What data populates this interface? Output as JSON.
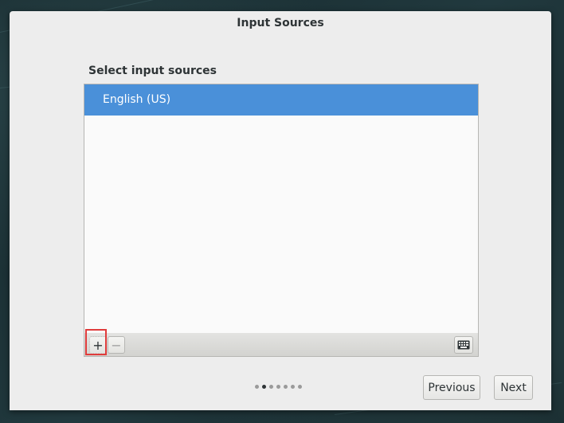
{
  "window": {
    "title": "Input Sources"
  },
  "section": {
    "label": "Select input sources"
  },
  "input_sources": {
    "items": [
      {
        "label": "English (US)",
        "selected": true
      }
    ]
  },
  "toolbar": {
    "add_label": "+",
    "remove_label": "−",
    "add_icon": "plus-icon",
    "remove_icon": "minus-icon",
    "keyboard_icon": "keyboard-icon"
  },
  "pager": {
    "total_pages": 7,
    "current_page": 2
  },
  "nav": {
    "previous_label": "Previous",
    "next_label": "Next"
  },
  "colors": {
    "selection": "#4a90d9",
    "highlight": "#e03c3c"
  }
}
